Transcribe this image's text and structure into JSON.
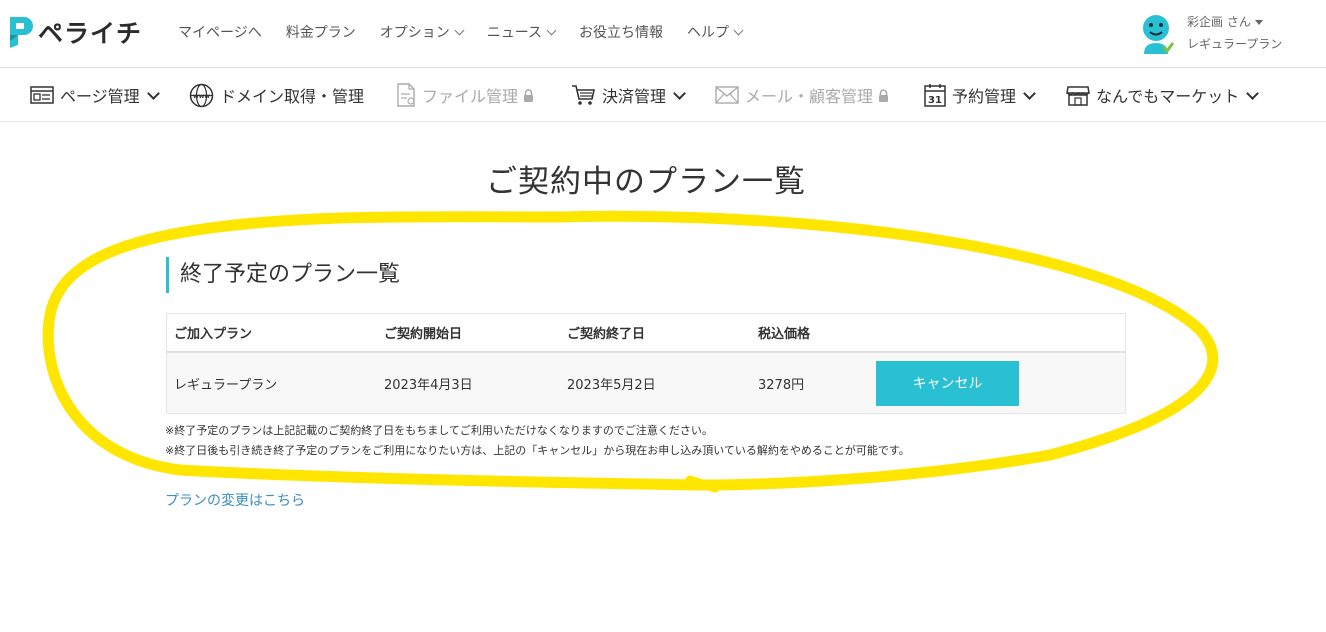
{
  "brand": {
    "name": "ペライチ",
    "accent": "#29c0d3"
  },
  "top_nav": {
    "items": [
      {
        "label": "マイページへ",
        "dropdown": false
      },
      {
        "label": "料金プラン",
        "dropdown": false
      },
      {
        "label": "オプション",
        "dropdown": true
      },
      {
        "label": "ニュース",
        "dropdown": true
      },
      {
        "label": "お役立ち情報",
        "dropdown": false
      },
      {
        "label": "ヘルプ",
        "dropdown": true
      }
    ]
  },
  "user": {
    "name": "彩企画 さん",
    "plan": "レギュラープラン"
  },
  "main_nav": {
    "items": [
      {
        "label": "ページ管理",
        "icon": "page-icon",
        "dropdown": true,
        "disabled": false
      },
      {
        "label": "ドメイン取得・管理",
        "icon": "globe-icon",
        "dropdown": false,
        "disabled": false
      },
      {
        "label": "ファイル管理",
        "icon": "file-icon",
        "dropdown": false,
        "disabled": true
      },
      {
        "label": "決済管理",
        "icon": "cart-icon",
        "dropdown": true,
        "disabled": false
      },
      {
        "label": "メール・顧客管理",
        "icon": "mail-icon",
        "dropdown": false,
        "disabled": true
      },
      {
        "label": "予約管理",
        "icon": "calendar-icon",
        "dropdown": true,
        "disabled": false,
        "icon_text": "31"
      },
      {
        "label": "なんでもマーケット",
        "icon": "store-icon",
        "dropdown": true,
        "disabled": false
      }
    ]
  },
  "page": {
    "title": "ご契約中のプラン一覧",
    "section_title": "終了予定のプラン一覧",
    "table": {
      "headers": [
        "ご加入プラン",
        "ご契約開始日",
        "ご契約終了日",
        "税込価格",
        ""
      ],
      "rows": [
        {
          "plan": "レギュラープラン",
          "start": "2023年4月3日",
          "end": "2023年5月2日",
          "price": "3278円",
          "action": "キャンセル"
        }
      ]
    },
    "notes": [
      "※終了予定のプランは上記記載のご契約終了日をもちましてご利用いただけなくなりますのでご注意ください。",
      "※終了日後も引き続き終了予定のプランをご利用になりたい方は、上記の「キャンセル」から現在お申し込み頂いている解約をやめることが可能です。"
    ],
    "change_link": "プランの変更はこちら"
  },
  "colors": {
    "accent": "#29c0d3",
    "title_underline": "#3cbf6d",
    "highlight": "#ffe600",
    "link": "#3a8fc0"
  }
}
